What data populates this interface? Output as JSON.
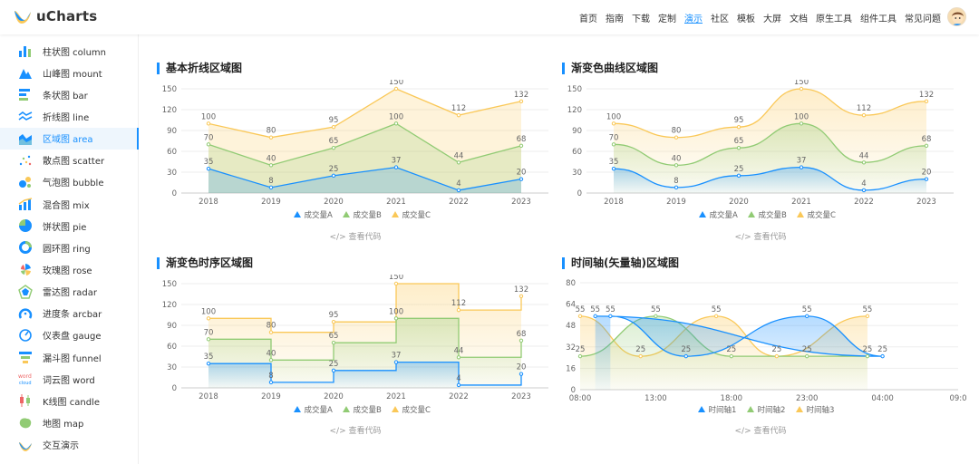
{
  "header": {
    "logo_text": "uCharts",
    "nav": [
      "首页",
      "指南",
      "下载",
      "定制",
      "演示",
      "社区",
      "模板",
      "大屏",
      "文档",
      "原生工具",
      "组件工具",
      "常见问题"
    ],
    "active_nav": "演示"
  },
  "sidebar": {
    "items": [
      {
        "label": "柱状图  column",
        "icon": "column-chart-icon"
      },
      {
        "label": "山峰图  mount",
        "icon": "mountain-chart-icon"
      },
      {
        "label": "条状图  bar",
        "icon": "bar-chart-icon"
      },
      {
        "label": "折线图  line",
        "icon": "line-chart-icon"
      },
      {
        "label": "区域图  area",
        "icon": "area-chart-icon"
      },
      {
        "label": "散点图  scatter",
        "icon": "scatter-chart-icon"
      },
      {
        "label": "气泡图  bubble",
        "icon": "bubble-chart-icon"
      },
      {
        "label": "混合图  mix",
        "icon": "mix-chart-icon"
      },
      {
        "label": "饼状图  pie",
        "icon": "pie-chart-icon"
      },
      {
        "label": "圆环图  ring",
        "icon": "ring-chart-icon"
      },
      {
        "label": "玫瑰图  rose",
        "icon": "rose-chart-icon"
      },
      {
        "label": "雷达图  radar",
        "icon": "radar-chart-icon"
      },
      {
        "label": "进度条  arcbar",
        "icon": "arcbar-chart-icon"
      },
      {
        "label": "仪表盘  gauge",
        "icon": "gauge-chart-icon"
      },
      {
        "label": "漏斗图  funnel",
        "icon": "funnel-chart-icon"
      },
      {
        "label": "词云图  word",
        "icon": "word-cloud-icon"
      },
      {
        "label": "K线图  candle",
        "icon": "candle-chart-icon"
      },
      {
        "label": "地图  map",
        "icon": "map-chart-icon"
      },
      {
        "label": "交互演示",
        "icon": "interaction-demo-icon"
      }
    ],
    "active_index": 4
  },
  "colors": {
    "A": "#1890ff",
    "B": "#91cb74",
    "C": "#fac858",
    "accent": "#1890ff"
  },
  "code_link_label": "</> 查看代码",
  "chart_data": [
    {
      "type": "area",
      "title": "基本折线区域图",
      "style": "straight",
      "categories": [
        "2018",
        "2019",
        "2020",
        "2021",
        "2022",
        "2023"
      ],
      "ylim": [
        0,
        150
      ],
      "yticks": [
        0,
        30,
        60,
        90,
        120,
        150
      ],
      "legend_position": "bottom",
      "series": [
        {
          "name": "成交量A",
          "values": [
            35,
            8,
            25,
            37,
            4,
            20
          ]
        },
        {
          "name": "成交量B",
          "values": [
            70,
            40,
            65,
            100,
            44,
            68
          ]
        },
        {
          "name": "成交量C",
          "values": [
            100,
            80,
            95,
            150,
            112,
            132
          ]
        }
      ]
    },
    {
      "type": "area",
      "title": "渐变色曲线区域图",
      "style": "curve",
      "categories": [
        "2018",
        "2019",
        "2020",
        "2021",
        "2022",
        "2023"
      ],
      "ylim": [
        0,
        150
      ],
      "yticks": [
        0,
        30,
        60,
        90,
        120,
        150
      ],
      "legend_position": "bottom",
      "series": [
        {
          "name": "成交量A",
          "values": [
            35,
            8,
            25,
            37,
            4,
            20
          ]
        },
        {
          "name": "成交量B",
          "values": [
            70,
            40,
            65,
            100,
            44,
            68
          ]
        },
        {
          "name": "成交量C",
          "values": [
            100,
            80,
            95,
            150,
            112,
            132
          ]
        }
      ]
    },
    {
      "type": "area",
      "title": "渐变色时序区域图",
      "style": "step",
      "categories": [
        "2018",
        "2019",
        "2020",
        "2021",
        "2022",
        "2023"
      ],
      "ylim": [
        0,
        150
      ],
      "yticks": [
        0,
        30,
        60,
        90,
        120,
        150
      ],
      "legend_position": "bottom",
      "series": [
        {
          "name": "成交量A",
          "values": [
            35,
            8,
            25,
            37,
            4,
            20
          ]
        },
        {
          "name": "成交量B",
          "values": [
            70,
            40,
            65,
            100,
            44,
            68
          ]
        },
        {
          "name": "成交量C",
          "values": [
            100,
            80,
            95,
            150,
            112,
            132
          ]
        }
      ]
    },
    {
      "type": "area",
      "title": "时间轴(矢量轴)区域图",
      "style": "curve",
      "x_ticks": [
        "08:00",
        "13:00",
        "18:00",
        "23:00",
        "04:00",
        "09:0"
      ],
      "ylim": [
        0,
        80
      ],
      "yticks": [
        0,
        16,
        32,
        48,
        64,
        80
      ],
      "legend_position": "bottom",
      "series": [
        {
          "name": "时间轴1",
          "points": [
            [
              "10:00",
              55
            ],
            [
              "15:00",
              25
            ],
            [
              "23:00",
              55
            ],
            [
              "04:00",
              25
            ],
            [
              "09:00",
              55
            ]
          ]
        },
        {
          "name": "时间轴2",
          "points": [
            [
              "08:00",
              25
            ],
            [
              "13:00",
              55
            ],
            [
              "18:00",
              25
            ],
            [
              "23:00",
              25
            ],
            [
              "03:00",
              25
            ]
          ]
        },
        {
          "name": "时间轴3",
          "points": [
            [
              "08:00",
              55
            ],
            [
              "12:00",
              25
            ],
            [
              "17:00",
              55
            ],
            [
              "21:00",
              25
            ],
            [
              "03:00",
              55
            ]
          ]
        }
      ]
    }
  ]
}
